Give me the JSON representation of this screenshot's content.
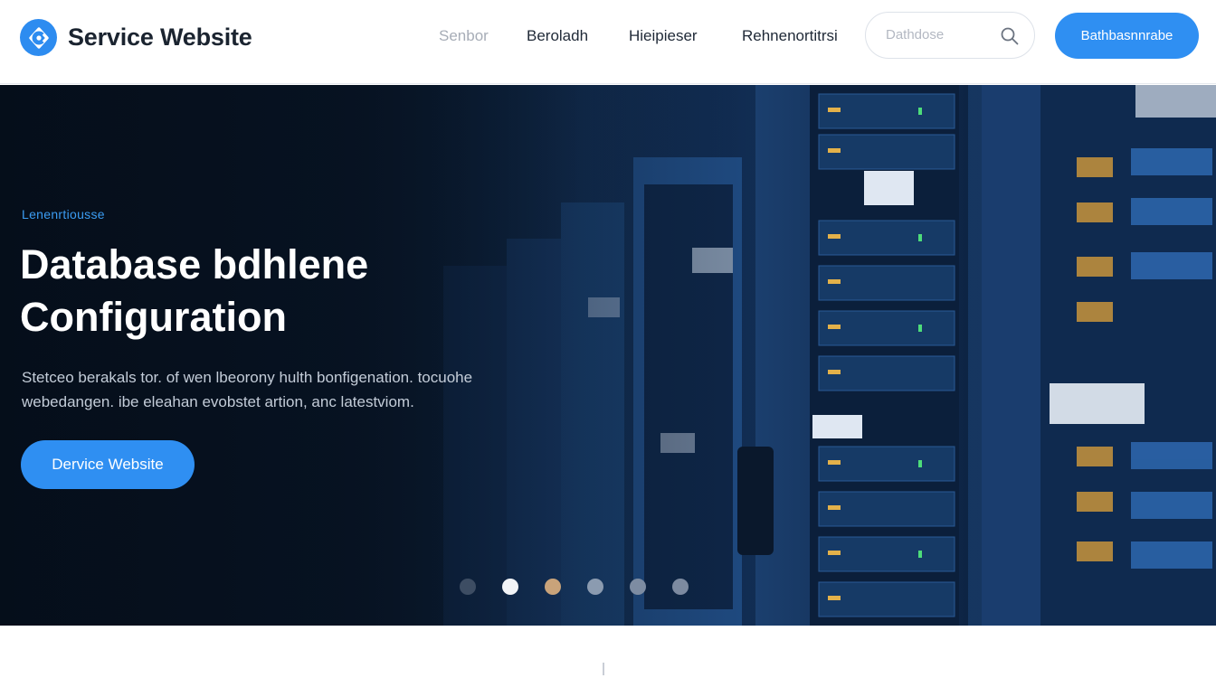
{
  "header": {
    "brand_name": "Service Website",
    "nav": [
      "Senbor",
      "Beroladh",
      "Hieipieser",
      "Rehnenortitrsi"
    ],
    "search_placeholder": "Dathdose",
    "cta_label": "Bathbasnnrabe"
  },
  "hero": {
    "eyebrow": "Lenenrtiousse",
    "title_line1": "Database bdhlene",
    "title_line2": "Configuration",
    "desc_line1": "Stetceo berakals tor. of wen lbeorony hulth bonfigenation. tocuohe",
    "desc_line2": "webedangen. ibe eleahan evobstet artion, anc latestviom.",
    "button_label": "Dervice Website"
  },
  "carousel": {
    "count": 6,
    "active_index": 1,
    "dot_colors": [
      "#3d4d63",
      "#f2f4f7",
      "#c9a37a",
      "#8b9bb0",
      "#7d8ca2",
      "#7c8aa0"
    ]
  },
  "colors": {
    "accent": "#2f8ff2",
    "eyebrow": "#3b9cf2"
  }
}
